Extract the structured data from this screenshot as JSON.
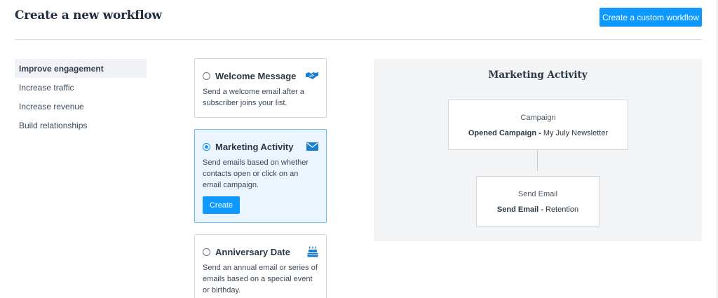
{
  "header": {
    "title": "Create a new workflow",
    "custom_button_label": "Create a custom workflow"
  },
  "sidebar": {
    "items": [
      {
        "label": "Improve engagement",
        "active": true
      },
      {
        "label": "Increase traffic"
      },
      {
        "label": "Increase revenue"
      },
      {
        "label": "Build relationships"
      }
    ]
  },
  "templates": [
    {
      "title": "Welcome Message",
      "icon": "handshake-icon",
      "description": "Send a welcome email after a subscriber joins your list.",
      "selected": false
    },
    {
      "title": "Marketing Activity",
      "icon": "envelope-icon",
      "description": "Send emails based on whether contacts open or click on an email campaign.",
      "selected": true,
      "create_label": "Create"
    },
    {
      "title": "Anniversary Date",
      "icon": "cake-icon",
      "description": "Send an annual email or series of emails based on a special event or birthday.",
      "selected": false
    }
  ],
  "preview": {
    "title": "Marketing Activity",
    "nodes": [
      {
        "label": "Campaign",
        "detail_strong": "Opened Campaign -",
        "detail_rest": " My July Newsletter"
      },
      {
        "label": "Send Email",
        "detail_strong": "Send Email -",
        "detail_rest": " Retention"
      }
    ]
  },
  "colors": {
    "accent": "#0d99ff",
    "selected_bg": "#eaf5ff",
    "selected_border": "#6dbbf6",
    "heading": "#1f2d3d"
  }
}
